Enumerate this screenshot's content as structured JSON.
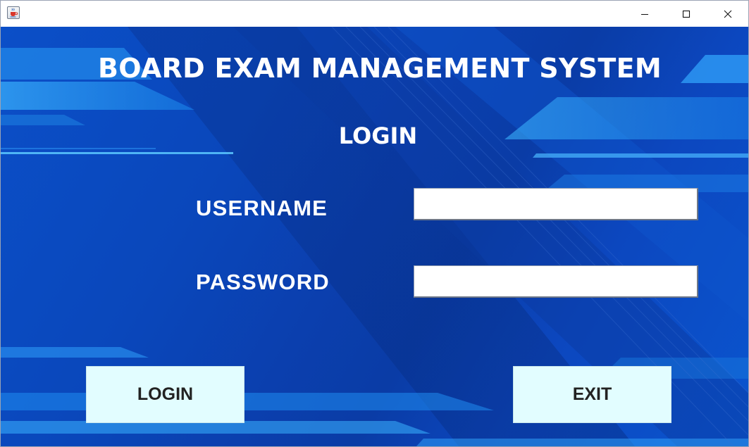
{
  "window": {
    "app_icon": "java-coffee-cup-icon",
    "controls": {
      "minimize_icon": "minimize-icon",
      "maximize_icon": "maximize-icon",
      "close_icon": "close-icon"
    }
  },
  "header": {
    "title": "BOARD EXAM MANAGEMENT SYSTEM",
    "subtitle": "LOGIN"
  },
  "form": {
    "username_label": "USERNAME",
    "username_value": "",
    "password_label": "PASSWORD",
    "password_value": ""
  },
  "actions": {
    "login_label": "LOGIN",
    "exit_label": "EXIT"
  },
  "colors": {
    "background": "#0a47bb",
    "button_background": "#e2fdff",
    "heading_text": "#ffffff",
    "button_text": "#222222"
  }
}
